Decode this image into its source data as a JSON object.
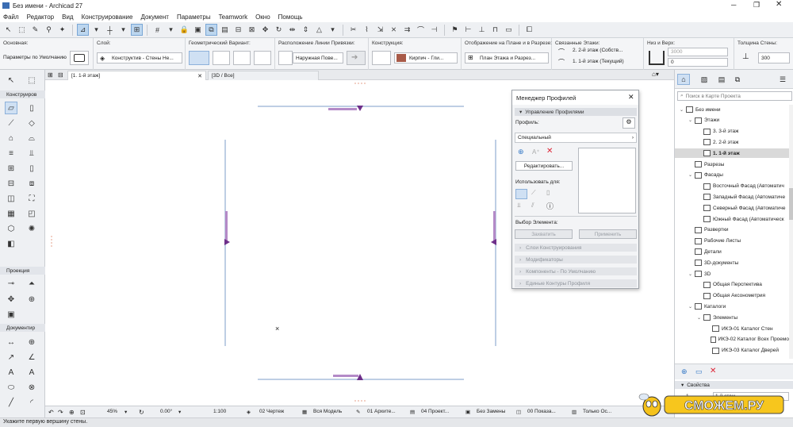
{
  "window": {
    "title": "Без имени - Archicad 27"
  },
  "menu": [
    "Файл",
    "Редактор",
    "Вид",
    "Конструирование",
    "Документ",
    "Параметры",
    "Teamwork",
    "Окно",
    "Помощь"
  ],
  "infobox": {
    "basic_label": "Основная:",
    "basic_value": "Параметры по Умолчанию",
    "layer_label": "Слой:",
    "layer_value": "Конструктив - Стены Не...",
    "geometry_label": "Геометрический Вариант:",
    "refline_label": "Расположение Линии Привязки:",
    "refline_value": "Наружная Пове...",
    "structure_label": "Конструкция:",
    "structure_value": "Кирпич - Гли...",
    "display_label": "Отображение на Плане и в Разрезе:",
    "display_value": "План Этажа и Разрез...",
    "stories_label": "Связанные Этажи:",
    "story_top": "2. 2-й этаж (Собств...",
    "story_bottom": "1. 1-й этаж (Текущий)",
    "topbottom_label": "Низ и Верх:",
    "top_value": "3000",
    "bottom_value": "0",
    "thickness_label": "Толщина Стены:",
    "thickness_value": "300"
  },
  "tabs": {
    "floor": "[1. 1-й этаж]",
    "3d": "[3D / Все]"
  },
  "toolbox": {
    "design": "Конструиров",
    "view": "Проекция",
    "document": "Документир"
  },
  "dialog": {
    "title": "Менеджер Профилей",
    "section_manage": "Управление Профилями",
    "profile_label": "Профиль:",
    "profile_type": "Специальный",
    "edit_button": "Редактировать...",
    "use_for": "Использовать для:",
    "element_pick": "Выбор Элемента:",
    "capture_button": "Захватить",
    "apply_button": "Применить",
    "sections": [
      "Слои Конструирования",
      "Модификаторы",
      "Компоненты - По Умолчанию",
      "Единые Контуры Профиля"
    ]
  },
  "navigator": {
    "search_placeholder": "Поиск в Карте Проекта",
    "tree": [
      {
        "label": "Без имени",
        "level": 0,
        "icon": "house-icon",
        "exp": "v"
      },
      {
        "label": "Этажи",
        "level": 1,
        "icon": "stories-icon",
        "exp": "v"
      },
      {
        "label": "3. 3-й этаж",
        "level": 2,
        "icon": "story-icon",
        "exp": ""
      },
      {
        "label": "2. 2-й этаж",
        "level": 2,
        "icon": "story-icon",
        "exp": ""
      },
      {
        "label": "1. 1-й этаж",
        "level": 2,
        "icon": "story-icon",
        "exp": "",
        "selected": true
      },
      {
        "label": "Разрезы",
        "level": 1,
        "icon": "section-icon",
        "exp": ""
      },
      {
        "label": "Фасады",
        "level": 1,
        "icon": "elevation-icon",
        "exp": "v"
      },
      {
        "label": "Восточный Фасад (Автоматич",
        "level": 2,
        "icon": "elevation-icon",
        "exp": ""
      },
      {
        "label": "Западный Фасад (Автоматиче",
        "level": 2,
        "icon": "elevation-icon",
        "exp": ""
      },
      {
        "label": "Северный Фасад (Автоматиче",
        "level": 2,
        "icon": "elevation-icon",
        "exp": ""
      },
      {
        "label": "Южный Фасад (Автоматическ",
        "level": 2,
        "icon": "elevation-icon",
        "exp": ""
      },
      {
        "label": "Развертки",
        "level": 1,
        "icon": "interior-icon",
        "exp": ""
      },
      {
        "label": "Рабочие Листы",
        "level": 1,
        "icon": "worksheet-icon",
        "exp": ""
      },
      {
        "label": "Детали",
        "level": 1,
        "icon": "detail-icon",
        "exp": ""
      },
      {
        "label": "3D-документы",
        "level": 1,
        "icon": "3d-doc-icon",
        "exp": ""
      },
      {
        "label": "3D",
        "level": 1,
        "icon": "3d-icon",
        "exp": "v"
      },
      {
        "label": "Общая Перспектива",
        "level": 2,
        "icon": "cube-icon",
        "exp": ""
      },
      {
        "label": "Общая Аксонометрия",
        "level": 2,
        "icon": "cube-icon",
        "exp": ""
      },
      {
        "label": "Каталоги",
        "level": 1,
        "icon": "schedule-icon",
        "exp": "v"
      },
      {
        "label": "Элементы",
        "level": 2,
        "icon": "schedule-icon",
        "exp": "v"
      },
      {
        "label": "ИКЭ-01 Каталог Стен",
        "level": 3,
        "icon": "schedule-icon",
        "exp": ""
      },
      {
        "label": "ИКЭ-02 Каталог Всех Проемо",
        "level": 3,
        "icon": "schedule-icon",
        "exp": ""
      },
      {
        "label": "ИКЭ-03 Каталог Дверей",
        "level": 3,
        "icon": "schedule-icon",
        "exp": ""
      }
    ],
    "properties_label": "Свойства",
    "prop_num": "1.",
    "prop_value": "1-й этаж"
  },
  "statusbar": {
    "zoom": "45%",
    "angle": "0.00°",
    "scale": "1:100",
    "drawing": "02 Чертеж",
    "model": "Вся Модель",
    "arch": "01 Архите...",
    "project": "04 Проект...",
    "override": "Без Замены",
    "show": "00 Показа...",
    "only": "Только Ос..."
  },
  "hint": "Укажите первую вершину стены.",
  "colors": {
    "accent": "#6e2f8a",
    "select": "#cfe0f3",
    "canvas": "#ffffff",
    "line": "#7d9cc9"
  },
  "watermark": "СМОЖЕМ.РУ"
}
